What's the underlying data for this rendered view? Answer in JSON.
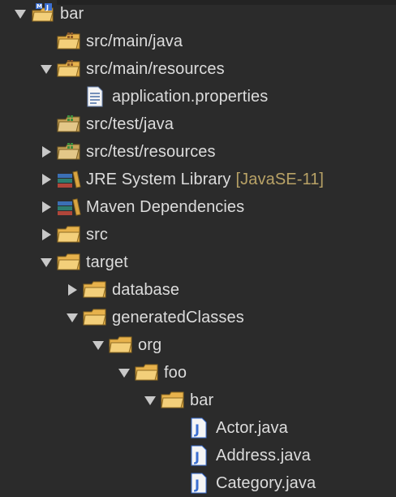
{
  "tree": {
    "items": [
      {
        "label": "bar",
        "twisty": "expanded",
        "icon": "project-folder-icon",
        "depth": 0
      },
      {
        "label": "src/main/java",
        "twisty": "none",
        "icon": "source-folder-icon",
        "depth": 1
      },
      {
        "label": "src/main/resources",
        "twisty": "expanded",
        "icon": "source-folder-icon",
        "depth": 1
      },
      {
        "label": "application.properties",
        "twisty": "none",
        "icon": "properties-file-icon",
        "depth": 2
      },
      {
        "label": "src/test/java",
        "twisty": "none",
        "icon": "test-source-folder-icon",
        "depth": 1
      },
      {
        "label": "src/test/resources",
        "twisty": "collapsed",
        "icon": "test-source-folder-icon",
        "depth": 1
      },
      {
        "label": "JRE System Library",
        "decoration": "[JavaSE-11]",
        "twisty": "collapsed",
        "icon": "library-icon",
        "depth": 1
      },
      {
        "label": "Maven Dependencies",
        "twisty": "collapsed",
        "icon": "library-icon",
        "depth": 1
      },
      {
        "label": "src",
        "twisty": "collapsed",
        "icon": "folder-icon",
        "depth": 1
      },
      {
        "label": "target",
        "twisty": "expanded",
        "icon": "folder-icon",
        "depth": 1
      },
      {
        "label": "database",
        "twisty": "collapsed",
        "icon": "folder-icon",
        "depth": 2
      },
      {
        "label": "generatedClasses",
        "twisty": "expanded",
        "icon": "folder-icon",
        "depth": 2
      },
      {
        "label": "org",
        "twisty": "expanded",
        "icon": "folder-icon",
        "depth": 3
      },
      {
        "label": "foo",
        "twisty": "expanded",
        "icon": "folder-icon",
        "depth": 4
      },
      {
        "label": "bar",
        "twisty": "expanded",
        "icon": "folder-icon",
        "depth": 5
      },
      {
        "label": "Actor.java",
        "twisty": "none",
        "icon": "java-file-icon",
        "depth": 6
      },
      {
        "label": "Address.java",
        "twisty": "none",
        "icon": "java-file-icon",
        "depth": 6
      },
      {
        "label": "Category.java",
        "twisty": "none",
        "icon": "java-file-icon",
        "depth": 6
      }
    ]
  },
  "colors": {
    "background": "#2b2b2b",
    "text": "#dcdcdc",
    "decoration": "#b8a266",
    "twisty": "#c8c8c8",
    "folder": "#e7b24c",
    "java_blue": "#3b6fd1"
  }
}
